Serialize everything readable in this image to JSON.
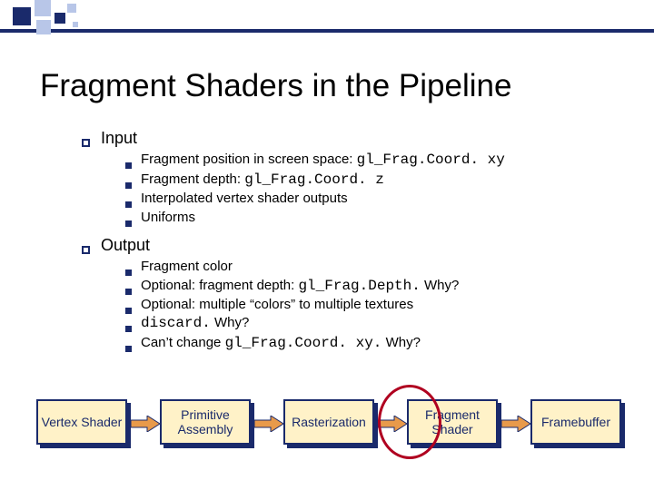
{
  "title": "Fragment Shaders in the Pipeline",
  "sections": [
    {
      "label": "Input",
      "items": [
        {
          "textBefore": "Fragment position in screen space: ",
          "code": "gl_Frag.Coord. xy",
          "textAfter": ""
        },
        {
          "textBefore": "Fragment depth: ",
          "code": "gl_Frag.Coord. z",
          "textAfter": ""
        },
        {
          "textBefore": "Interpolated vertex shader outputs",
          "code": "",
          "textAfter": ""
        },
        {
          "textBefore": "Uniforms",
          "code": "",
          "textAfter": ""
        }
      ]
    },
    {
      "label": "Output",
      "items": [
        {
          "textBefore": "Fragment color",
          "code": "",
          "textAfter": ""
        },
        {
          "textBefore": "Optional:  fragment depth: ",
          "code": "gl_Frag.Depth.",
          "textAfter": "  Why?"
        },
        {
          "textBefore": "Optional:  multiple “colors” to multiple textures",
          "code": "",
          "textAfter": ""
        },
        {
          "textBefore": "",
          "code": "discard.",
          "textAfter": "  Why?"
        },
        {
          "textBefore": "Can’t change ",
          "code": "gl_Frag.Coord. xy.",
          "textAfter": "  Why?"
        }
      ]
    }
  ],
  "pipeline": {
    "stages": [
      "Vertex Shader",
      "Primitive Assembly",
      "Rasterization",
      "Fragment Shader",
      "Framebuffer"
    ],
    "highlightIndex": 3
  }
}
